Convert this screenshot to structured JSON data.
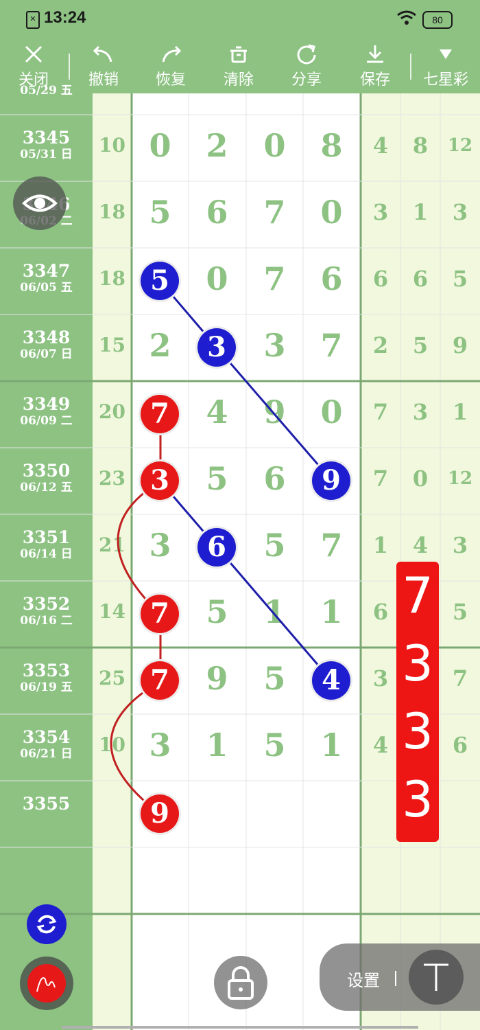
{
  "status": {
    "time": "13:24",
    "battery": "80",
    "sim_icon": "sim-off-icon"
  },
  "toolbar": {
    "items": [
      {
        "label": "关闭",
        "icon": "close-icon"
      },
      {
        "label": "撤销",
        "icon": "undo-icon"
      },
      {
        "label": "恢复",
        "icon": "redo-icon"
      },
      {
        "label": "清除",
        "icon": "trash-icon"
      },
      {
        "label": "分享",
        "icon": "share-icon"
      },
      {
        "label": "保存",
        "icon": "download-icon"
      },
      {
        "label": "七星彩",
        "icon": "dropdown-triangle-icon"
      }
    ]
  },
  "top_partial": {
    "label": "05/29 五"
  },
  "rows": [
    {
      "issue": "3345",
      "date": "05/31 日",
      "sum": "10",
      "digits": [
        "0",
        "2",
        "0",
        "8"
      ],
      "right": [
        "4",
        "8",
        "12"
      ]
    },
    {
      "issue": "3346",
      "date": "06/02 二",
      "sum": "18",
      "digits": [
        "5",
        "6",
        "7",
        "0"
      ],
      "right": [
        "3",
        "1",
        "3"
      ]
    },
    {
      "issue": "3347",
      "date": "06/05 五",
      "sum": "18",
      "digits": [
        "5",
        "0",
        "7",
        "6"
      ],
      "right": [
        "6",
        "6",
        "5"
      ]
    },
    {
      "issue": "3348",
      "date": "06/07 日",
      "sum": "15",
      "digits": [
        "2",
        "3",
        "3",
        "7"
      ],
      "right": [
        "2",
        "5",
        "9"
      ]
    },
    {
      "issue": "3349",
      "date": "06/09 二",
      "sum": "20",
      "digits": [
        "7",
        "4",
        "9",
        "0"
      ],
      "right": [
        "7",
        "3",
        "1"
      ]
    },
    {
      "issue": "3350",
      "date": "06/12 五",
      "sum": "23",
      "digits": [
        "3",
        "5",
        "6",
        "9"
      ],
      "right": [
        "7",
        "0",
        "12"
      ]
    },
    {
      "issue": "3351",
      "date": "06/14 日",
      "sum": "21",
      "digits": [
        "3",
        "6",
        "5",
        "7"
      ],
      "right": [
        "1",
        "4",
        "3"
      ]
    },
    {
      "issue": "3352",
      "date": "06/16 二",
      "sum": "14",
      "digits": [
        "7",
        "5",
        "1",
        "1"
      ],
      "right": [
        "6",
        "",
        "5"
      ]
    },
    {
      "issue": "3353",
      "date": "06/19 五",
      "sum": "25",
      "digits": [
        "7",
        "9",
        "5",
        "4"
      ],
      "right": [
        "3",
        "",
        "7"
      ]
    },
    {
      "issue": "3354",
      "date": "06/21 日",
      "sum": "10",
      "digits": [
        "3",
        "1",
        "5",
        "1"
      ],
      "right": [
        "4",
        "",
        "6"
      ]
    },
    {
      "issue": "3355",
      "date": "",
      "sum": "",
      "digits": [
        "9",
        "",
        "",
        ""
      ],
      "right": [
        "",
        "",
        ""
      ]
    }
  ],
  "prediction": [
    "7",
    "3",
    "3",
    "3"
  ],
  "controls": {
    "settings_label": "设置",
    "t_label": "T"
  },
  "colors": {
    "green": "#8dc283",
    "light": "#f1f8dd",
    "blue": "#1e1ed0",
    "red": "#e71818"
  }
}
